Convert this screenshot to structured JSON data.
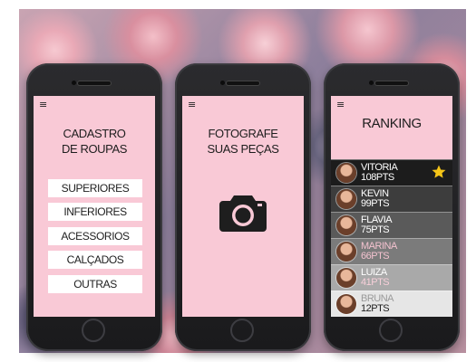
{
  "screens": {
    "cadastro": {
      "menu_icon": "≡",
      "title_line1": "CADASTRO",
      "title_line2": "DE ROUPAS",
      "buttons": [
        "SUPERIORES",
        "INFERIORES",
        "ACESSORIOS",
        "CALÇADOS",
        "OUTRAS"
      ]
    },
    "fotografe": {
      "menu_icon": "≡",
      "title_line1": "FOTOGRAFE",
      "title_line2": "SUAS PEÇAS",
      "icon": "camera-icon"
    },
    "ranking": {
      "menu_icon": "≡",
      "title": "RANKING",
      "entries": [
        {
          "name": "VITORIA",
          "points": "108PTS",
          "bg": "#1c1c1c",
          "name_color": "#ffffff",
          "pts_color": "#ffffff",
          "badge": "star-icon"
        },
        {
          "name": "KEVIN",
          "points": "99PTS",
          "bg": "#3d3d3d",
          "name_color": "#ffffff",
          "pts_color": "#ffffff"
        },
        {
          "name": "FLAVIA",
          "points": "75PTS",
          "bg": "#5a5a5a",
          "name_color": "#ffffff",
          "pts_color": "#ffffff"
        },
        {
          "name": "MARINA",
          "points": "66PTS",
          "bg": "#7b7b7b",
          "name_color": "#f3c2cf",
          "pts_color": "#f3c2cf"
        },
        {
          "name": "LUIZA",
          "points": "41PTS",
          "bg": "#a9a9a9",
          "name_color": "#ffffff",
          "pts_color": "#f7cfd9"
        },
        {
          "name": "BRUNA",
          "points": "12PTS",
          "bg": "#e6e6e6",
          "name_color": "#9a9a9a",
          "pts_color": "#1e1e1e"
        }
      ]
    }
  },
  "colors": {
    "screen_pink": "#f9c9d6",
    "star_yellow": "#f5c518",
    "phone_body": "#1a1a1c"
  }
}
